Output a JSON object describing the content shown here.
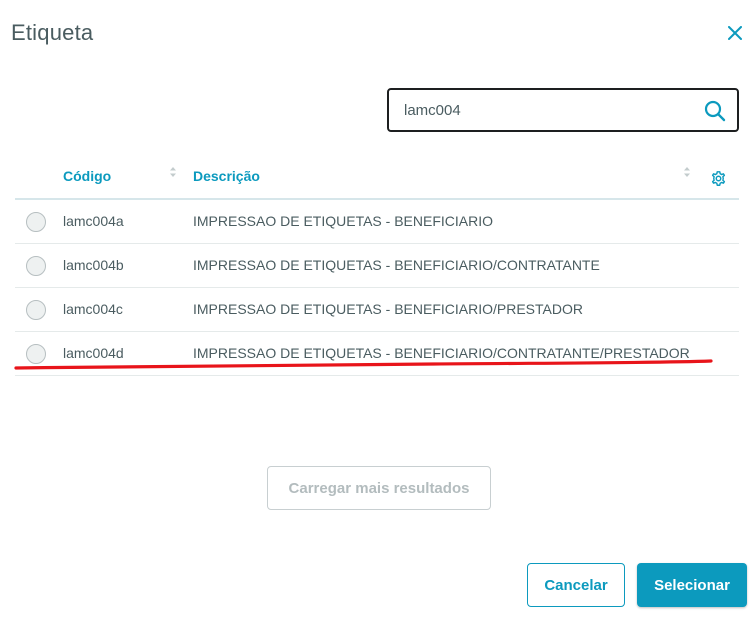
{
  "dialog": {
    "title": "Etiqueta",
    "close_icon": "close-icon"
  },
  "search": {
    "value": "lamc004",
    "icon": "search-icon"
  },
  "table": {
    "columns": [
      {
        "label": "Código",
        "sortable": true
      },
      {
        "label": "Descrição",
        "sortable": true
      }
    ],
    "settings_icon": "gear-icon",
    "rows": [
      {
        "code": "lamc004a",
        "description": "IMPRESSAO DE ETIQUETAS - BENEFICIARIO"
      },
      {
        "code": "lamc004b",
        "description": "IMPRESSAO DE ETIQUETAS - BENEFICIARIO/CONTRATANTE"
      },
      {
        "code": "lamc004c",
        "description": "IMPRESSAO DE ETIQUETAS - BENEFICIARIO/PRESTADOR"
      },
      {
        "code": "lamc004d",
        "description": "IMPRESSAO DE ETIQUETAS - BENEFICIARIO/CONTRATANTE/PRESTADOR"
      }
    ]
  },
  "load_more": {
    "label": "Carregar mais resultados",
    "disabled": true
  },
  "footer": {
    "cancel_label": "Cancelar",
    "select_label": "Selecionar"
  },
  "annotation": {
    "color": "#e8141a",
    "marks_row": "lamc004d"
  },
  "colors": {
    "primary": "#0c9abe",
    "text": "#4a5c60",
    "header_border": "#d6e6ea",
    "annotation": "#e8141a"
  }
}
